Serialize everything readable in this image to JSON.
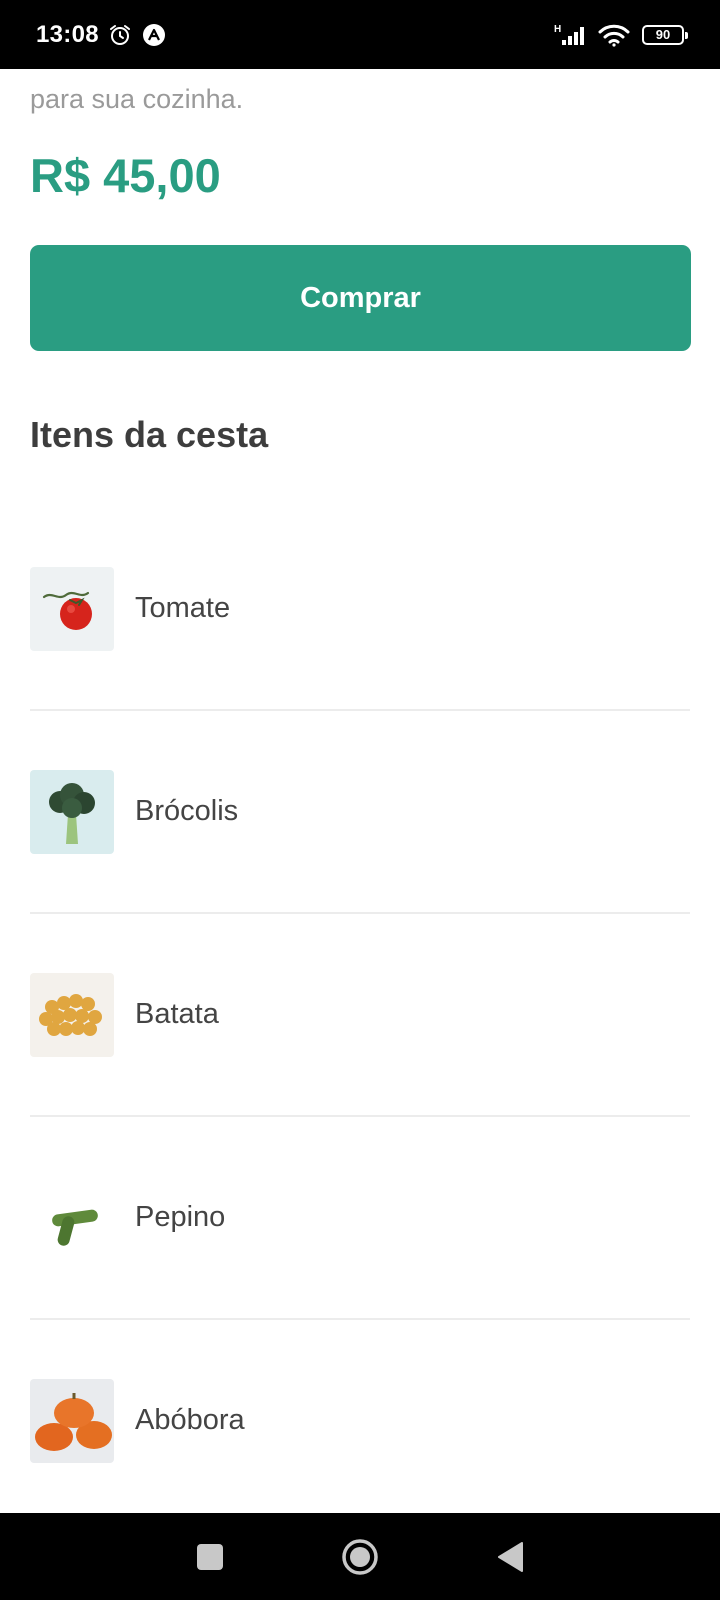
{
  "status_bar": {
    "time": "13:08",
    "battery": "90",
    "network": "H"
  },
  "product": {
    "description_tail": "para sua cozinha.",
    "price": "R$ 45,00",
    "buy_label": "Comprar"
  },
  "basket": {
    "title": "Itens da cesta",
    "items": [
      {
        "name": "Tomate",
        "image": "tomato-image"
      },
      {
        "name": "Brócolis",
        "image": "broccoli-image"
      },
      {
        "name": "Batata",
        "image": "potato-image"
      },
      {
        "name": "Pepino",
        "image": "cucumber-image"
      },
      {
        "name": "Abóbora",
        "image": "pumpkin-image"
      }
    ]
  },
  "colors": {
    "accent": "#2a9d82",
    "text_dark": "#3d3d3d",
    "text_muted": "#9a9a9a"
  },
  "nav": {
    "recent_icon": "square-icon",
    "home_icon": "circle-icon",
    "back_icon": "triangle-back-icon"
  }
}
